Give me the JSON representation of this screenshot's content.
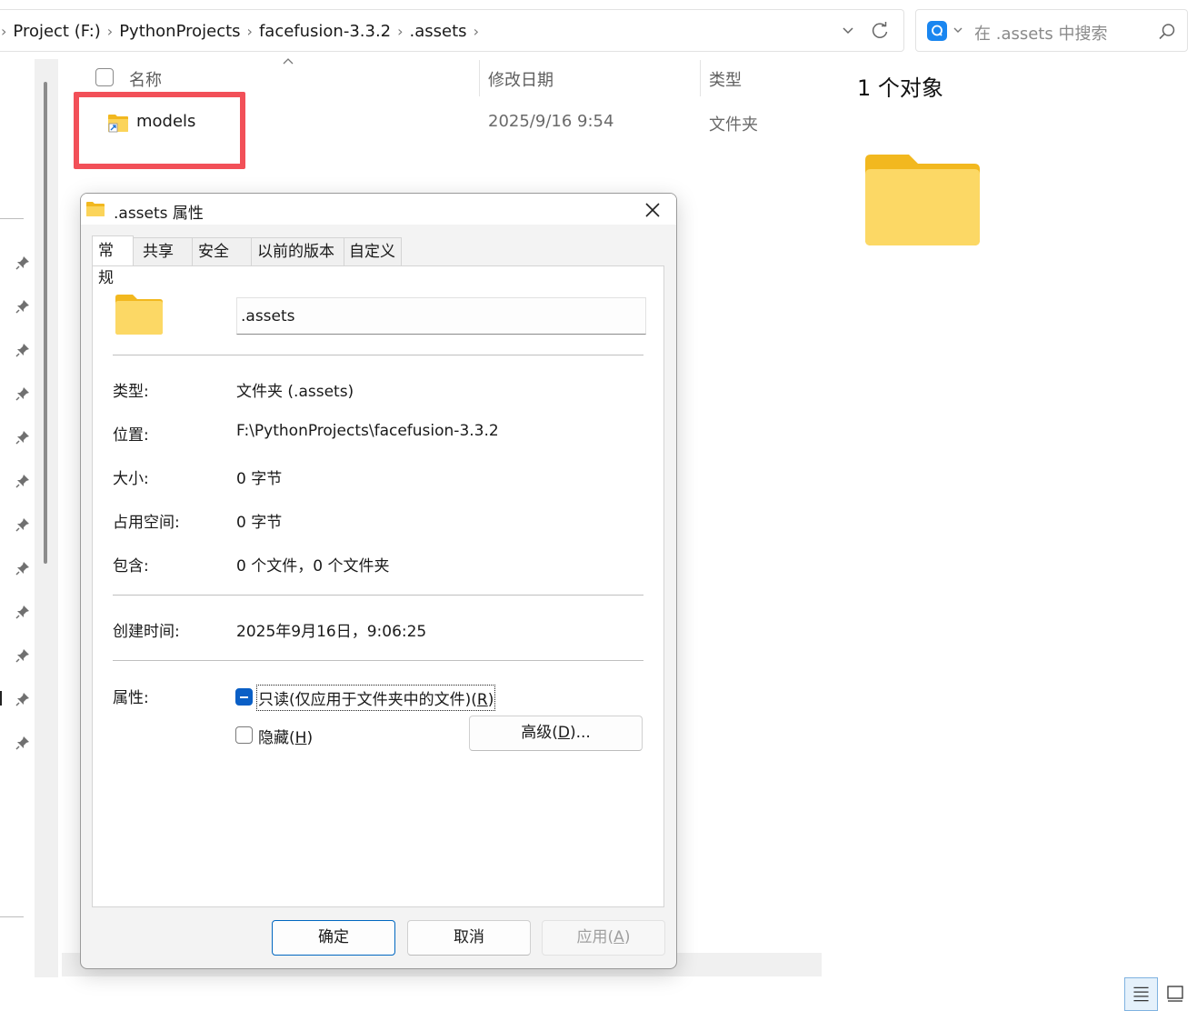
{
  "address_bar": {
    "leading_sep": "›",
    "crumbs": [
      "Project (F:)",
      "PythonProjects",
      "facefusion-3.3.2",
      ".assets"
    ],
    "sep": "›"
  },
  "search": {
    "placeholder": "在 .assets 中搜索"
  },
  "file_list": {
    "headers": {
      "name": "名称",
      "date": "修改日期",
      "type": "类型"
    },
    "rows": [
      {
        "name": "models",
        "date": "2025/9/16 9:54",
        "type": "文件夹"
      }
    ]
  },
  "preview": {
    "count": "1 个对象"
  },
  "dialog": {
    "title": ".assets 属性",
    "tabs": [
      "常规",
      "共享",
      "安全",
      "以前的版本",
      "自定义"
    ],
    "name_value": ".assets",
    "props": {
      "type_label": "类型:",
      "type_value": "文件夹 (.assets)",
      "location_label": "位置:",
      "location_value": "F:\\PythonProjects\\facefusion-3.3.2",
      "size_label": "大小:",
      "size_value": "0 字节",
      "disk_label": "占用空间:",
      "disk_value": "0 字节",
      "contains_label": "包含:",
      "contains_value": "0 个文件，0 个文件夹",
      "created_label": "创建时间:",
      "created_value": "2025年9月16日，9:06:25",
      "attributes_label": "属性:"
    },
    "readonly": {
      "text": "只读(仅应用于文件夹中的文件)(",
      "key": "R",
      "close": ")"
    },
    "hidden": {
      "text": "隐藏(",
      "key": "H",
      "close": ")"
    },
    "advanced": {
      "text": "高级(",
      "key": "D",
      "close": ")..."
    },
    "ok": "确定",
    "cancel": "取消",
    "apply": {
      "text": "应用(",
      "key": "A",
      "close": ")"
    }
  },
  "colors": {
    "accent": "#0067c0",
    "highlight": "#f25058",
    "folder": "#f8c840"
  }
}
